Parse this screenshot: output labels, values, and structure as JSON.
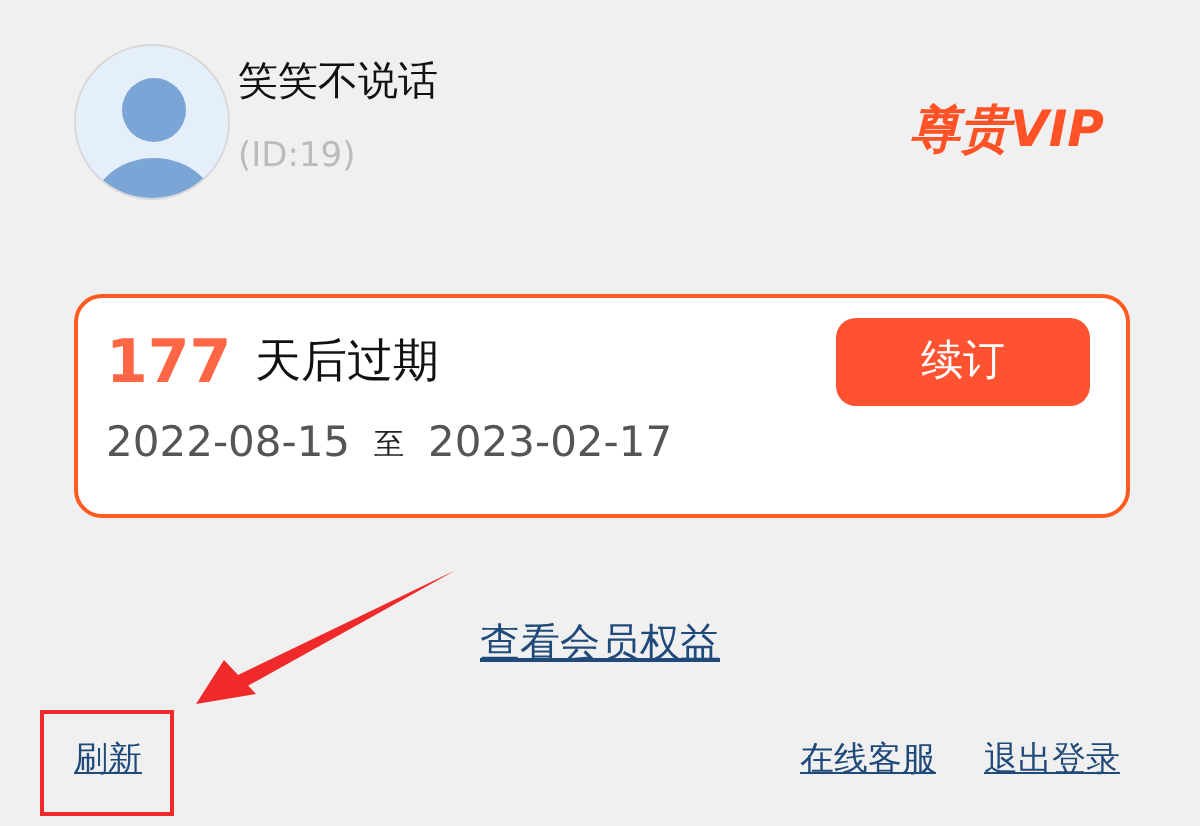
{
  "user": {
    "name": "笑笑不说话",
    "id": "(ID:19)",
    "badge": "尊贵VIP"
  },
  "membership": {
    "days": "177",
    "days_label": "天后过期",
    "start": "2022-08-15",
    "separator": "至",
    "end": "2023-02-17",
    "renew_button": "续订"
  },
  "benefits_link": "查看会员权益",
  "footer": {
    "refresh": "刷新",
    "links": [
      "在线客服",
      "退出登录"
    ]
  }
}
